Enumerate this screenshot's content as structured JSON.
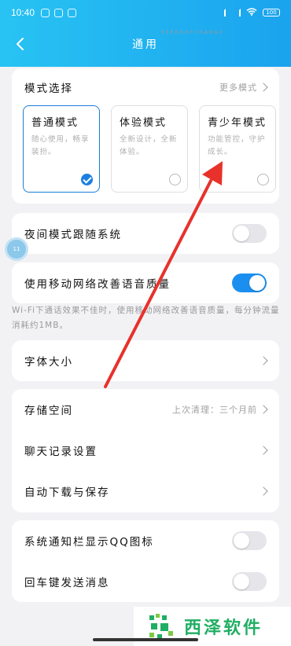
{
  "status_bar": {
    "time": "10:40",
    "battery": "100"
  },
  "header": {
    "title": "通用"
  },
  "mode_section": {
    "title": "模式选择",
    "more_label": "更多模式",
    "modes": [
      {
        "name": "普通模式",
        "desc": "随心使用，畅享装扮。",
        "selected": true
      },
      {
        "name": "体验模式",
        "desc": "全新设计，全新体验。",
        "selected": false
      },
      {
        "name": "青少年模式",
        "desc": "功能管控，守护成长。",
        "selected": false
      }
    ]
  },
  "night_mode": {
    "label": "夜间模式跟随系统",
    "enabled": false
  },
  "mobile_voice": {
    "label": "使用移动网络改善语音质量",
    "enabled": true,
    "hint": "Wi-Fi下通话效果不佳时，使用移动网络改善语音质量，每分钟流量消耗约1MB。"
  },
  "font_size": {
    "label": "字体大小"
  },
  "storage_group": {
    "storage_label": "存储空间",
    "storage_sub": "上次清理：三个月前",
    "chat_history_label": "聊天记录设置",
    "auto_download_label": "自动下载与保存"
  },
  "notify_group": {
    "qq_icon_label": "系统通知栏显示QQ图标",
    "qq_icon_enabled": false,
    "enter_send_label": "回车键发送消息",
    "enter_send_enabled": false
  },
  "floating_ball": {
    "text": "11"
  },
  "watermark": {
    "text": "西泽软件",
    "sub": "SEEDSOFCHANGE"
  },
  "colors": {
    "accent": "#1b8ff0",
    "header_start": "#28c3f3",
    "header_end": "#1aa3ee",
    "annotation_arrow": "#e8312b"
  }
}
